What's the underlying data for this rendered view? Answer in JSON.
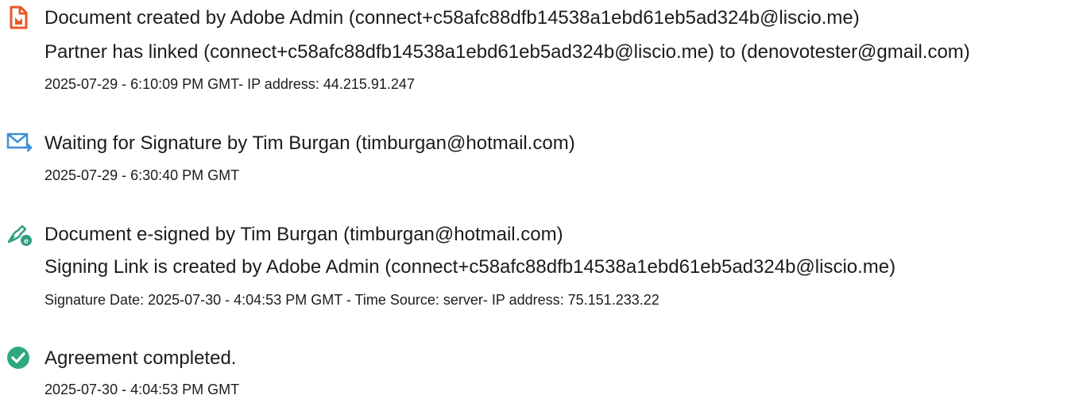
{
  "events": [
    {
      "icon": "document-created-icon",
      "lines": [
        "Document created by Adobe Admin (connect+c58afc88dfb14538a1ebd61eb5ad324b@liscio.me)",
        "Partner has linked (connect+c58afc88dfb14538a1ebd61eb5ad324b@liscio.me) to (denovotester@gmail.com)"
      ],
      "meta": "2025-07-29 - 6:10:09 PM GMT- IP address: 44.215.91.247"
    },
    {
      "icon": "email-sent-icon",
      "lines": [
        "Waiting for Signature by Tim Burgan (timburgan@hotmail.com)"
      ],
      "meta": "2025-07-29 - 6:30:40 PM GMT"
    },
    {
      "icon": "esign-pen-icon",
      "lines": [
        "Document e-signed by Tim Burgan (timburgan@hotmail.com)",
        "Signing Link is created by Adobe Admin (connect+c58afc88dfb14538a1ebd61eb5ad324b@liscio.me)"
      ],
      "meta": "Signature Date: 2025-07-30 - 4:04:53 PM GMT - Time Source: server- IP address: 75.151.233.22"
    },
    {
      "icon": "checkmark-circle-icon",
      "lines": [
        "Agreement completed."
      ],
      "meta": "2025-07-30 - 4:04:53 PM GMT"
    }
  ],
  "colors": {
    "created_icon": "#e8582a",
    "email_icon": "#3d8fd8",
    "esign_icon": "#2e9e82",
    "complete_icon": "#2ea882",
    "text": "#1c1c1c"
  }
}
